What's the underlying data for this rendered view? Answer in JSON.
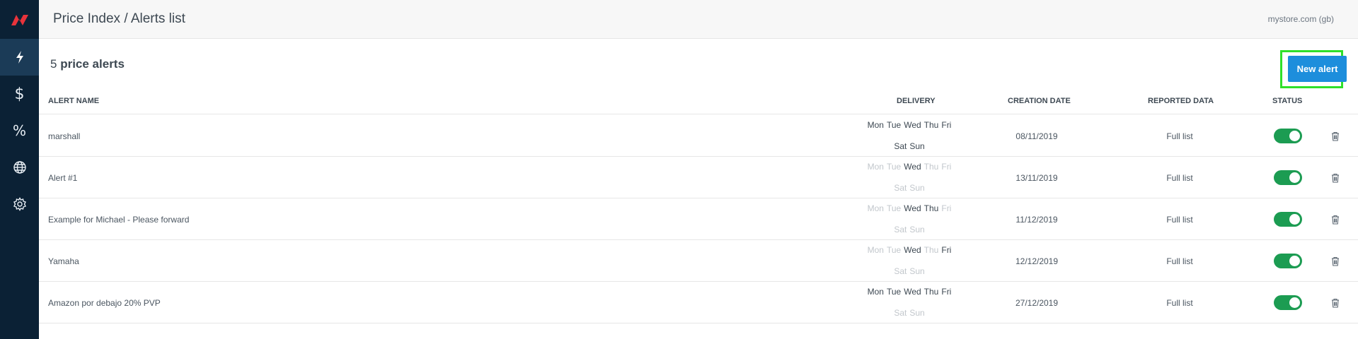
{
  "header": {
    "title": "Price Index / Alerts list",
    "store": "mystore.com (gb)"
  },
  "sidebar": {
    "items": [
      {
        "name": "alerts",
        "icon": "lightning-icon",
        "active": true
      },
      {
        "name": "pricing",
        "icon": "dollar-icon",
        "symbol": "$"
      },
      {
        "name": "discounts",
        "icon": "percent-icon",
        "symbol": "%"
      },
      {
        "name": "markets",
        "icon": "globe-icon"
      },
      {
        "name": "settings",
        "icon": "gear-icon"
      }
    ]
  },
  "alerts_summary": {
    "count": "5",
    "label": "price alerts"
  },
  "new_alert_label": "New alert",
  "table": {
    "headers": {
      "name": "ALERT NAME",
      "delivery": "DELIVERY",
      "created": "CREATION DATE",
      "reported": "REPORTED DATA",
      "status": "STATUS"
    },
    "rows": [
      {
        "name": "marshall",
        "created": "08/11/2019",
        "reported": "Full list",
        "status_on": true,
        "days": [
          {
            "d": "Mon",
            "on": true
          },
          {
            "d": "Tue",
            "on": true
          },
          {
            "d": "Wed",
            "on": true
          },
          {
            "d": "Thu",
            "on": true
          },
          {
            "d": "Fri",
            "on": true
          },
          {
            "d": "Sat",
            "on": true
          },
          {
            "d": "Sun",
            "on": true
          }
        ]
      },
      {
        "name": "Alert #1",
        "created": "13/11/2019",
        "reported": "Full list",
        "status_on": true,
        "days": [
          {
            "d": "Mon",
            "on": false
          },
          {
            "d": "Tue",
            "on": false
          },
          {
            "d": "Wed",
            "on": true
          },
          {
            "d": "Thu",
            "on": false
          },
          {
            "d": "Fri",
            "on": false
          },
          {
            "d": "Sat",
            "on": false
          },
          {
            "d": "Sun",
            "on": false
          }
        ]
      },
      {
        "name": "Example for Michael - Please forward",
        "created": "11/12/2019",
        "reported": "Full list",
        "status_on": true,
        "days": [
          {
            "d": "Mon",
            "on": false
          },
          {
            "d": "Tue",
            "on": false
          },
          {
            "d": "Wed",
            "on": true
          },
          {
            "d": "Thu",
            "on": true
          },
          {
            "d": "Fri",
            "on": false
          },
          {
            "d": "Sat",
            "on": false
          },
          {
            "d": "Sun",
            "on": false
          }
        ]
      },
      {
        "name": "Yamaha",
        "created": "12/12/2019",
        "reported": "Full list",
        "status_on": true,
        "days": [
          {
            "d": "Mon",
            "on": false
          },
          {
            "d": "Tue",
            "on": false
          },
          {
            "d": "Wed",
            "on": true
          },
          {
            "d": "Thu",
            "on": false
          },
          {
            "d": "Fri",
            "on": true
          },
          {
            "d": "Sat",
            "on": false
          },
          {
            "d": "Sun",
            "on": false
          }
        ]
      },
      {
        "name": "Amazon por debajo 20% PVP",
        "created": "27/12/2019",
        "reported": "Full list",
        "status_on": true,
        "days": [
          {
            "d": "Mon",
            "on": true
          },
          {
            "d": "Tue",
            "on": true
          },
          {
            "d": "Wed",
            "on": true
          },
          {
            "d": "Thu",
            "on": true
          },
          {
            "d": "Fri",
            "on": true
          },
          {
            "d": "Sat",
            "on": false
          },
          {
            "d": "Sun",
            "on": false
          }
        ]
      }
    ]
  },
  "colors": {
    "sidebar_bg": "#0b2135",
    "logo_red": "#e8333b",
    "button_blue": "#1d8edc",
    "toggle_green": "#1c9c52",
    "highlight_green": "#2fe02a"
  }
}
